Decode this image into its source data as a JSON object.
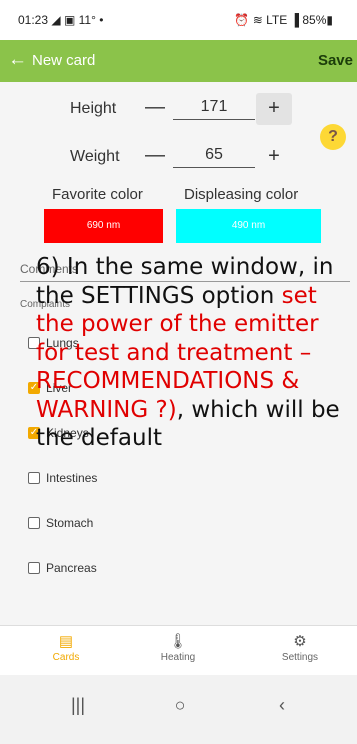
{
  "status_bar": {
    "time": "01:23",
    "left_icons": "◢ ▣ 11° •",
    "right_icons": "⏰ ≋ LTE ▐ 85%▮"
  },
  "app_bar": {
    "title": "New card",
    "save_label": "Save",
    "back_icon": "arrow-left-icon"
  },
  "form": {
    "height": {
      "label": "Height",
      "minus": "—",
      "value": "171",
      "plus": "+"
    },
    "weight": {
      "label": "Weight",
      "minus": "—",
      "value": "65",
      "plus": "+"
    },
    "help": "?"
  },
  "colors": {
    "favorite": {
      "label": "Favorite color",
      "value": "690 nm",
      "hex": "#ff0000"
    },
    "displeasing": {
      "label": "Displeasing color",
      "value": "490 nm",
      "hex": "#00ffff"
    }
  },
  "comments_label": "Comments",
  "complaints_label": "Complaints",
  "complaints": [
    {
      "name": "Lungs",
      "checked": false
    },
    {
      "name": "Liver",
      "checked": true
    },
    {
      "name": "Kidneys",
      "checked": true
    },
    {
      "name": "Intestines",
      "checked": false
    },
    {
      "name": "Stomach",
      "checked": false
    },
    {
      "name": "Pancreas",
      "checked": false
    }
  ],
  "overlay": {
    "part1": "6) In the same window, in the SETTINGS option ",
    "part2_red": "set the power of the emitter for test and treatment – RECOMMENDATIONS & WARNING ?)",
    "part3": ", which will be the default"
  },
  "bottom_nav": [
    {
      "label": "Cards",
      "icon": "cards-icon",
      "active": true
    },
    {
      "label": "Heating",
      "icon": "thermometer-icon",
      "active": false
    },
    {
      "label": "Settings",
      "icon": "gear-icon",
      "active": false
    }
  ],
  "system_nav": {
    "recents": "|||",
    "home": "○",
    "back": "‹"
  }
}
